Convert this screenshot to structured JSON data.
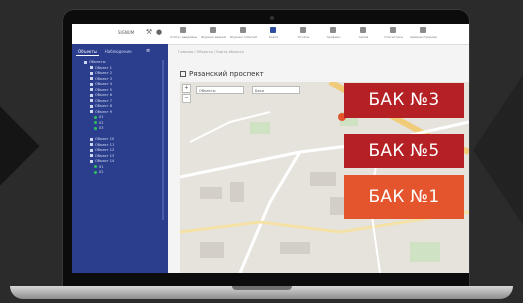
{
  "app": {
    "user_name": "SIGNUM",
    "nav_items": [
      {
        "label": "Статус аварийных",
        "icon": "status-icon"
      },
      {
        "label": "Журнал аварий",
        "icon": "journal-icon"
      },
      {
        "label": "Журнал событий",
        "icon": "events-icon"
      },
      {
        "label": "Карта",
        "icon": "map-icon",
        "active": true
      },
      {
        "label": "Отчёты",
        "icon": "reports-icon"
      },
      {
        "label": "Графики",
        "icon": "charts-icon"
      },
      {
        "label": "Архив",
        "icon": "archive-icon"
      },
      {
        "label": "Статистика",
        "icon": "stats-icon"
      },
      {
        "label": "Администрирование",
        "icon": "admin-icon"
      }
    ]
  },
  "sidebar": {
    "tabs": [
      "Объекты",
      "Наблюдение"
    ],
    "tree": [
      {
        "text": "Объекты",
        "type": "sq",
        "depth": 0
      },
      {
        "text": "Объект 1",
        "type": "sq",
        "depth": 1
      },
      {
        "text": "Объект 2",
        "type": "sq",
        "depth": 1
      },
      {
        "text": "Объект 3",
        "type": "sq",
        "depth": 1
      },
      {
        "text": "Объект 4",
        "type": "sq",
        "depth": 1
      },
      {
        "text": "Объект 5",
        "type": "sq",
        "depth": 1
      },
      {
        "text": "Объект 6",
        "type": "sq",
        "depth": 1
      },
      {
        "text": "Объект 7",
        "type": "sq",
        "depth": 1
      },
      {
        "text": "Объект 8",
        "type": "sq",
        "depth": 1
      },
      {
        "text": "Объект 9",
        "type": "sq",
        "depth": 1
      },
      {
        "text": "01",
        "type": "dot",
        "depth": 2
      },
      {
        "text": "02",
        "type": "dot",
        "depth": 2
      },
      {
        "text": "03",
        "type": "dot",
        "depth": 2
      },
      {
        "text": "",
        "type": "none",
        "depth": 1
      },
      {
        "text": "Объект 10",
        "type": "sq",
        "depth": 1
      },
      {
        "text": "Объект 11",
        "type": "sq",
        "depth": 1
      },
      {
        "text": "Объект 12",
        "type": "sq",
        "depth": 1
      },
      {
        "text": "Объект 13",
        "type": "sq",
        "depth": 1
      },
      {
        "text": "Объект 14",
        "type": "sq",
        "depth": 1
      },
      {
        "text": "01",
        "type": "dot",
        "depth": 2
      },
      {
        "text": "02",
        "type": "dot",
        "depth": 2
      }
    ]
  },
  "content": {
    "breadcrumb": "Главная / Объекты / Карта объекта",
    "page_title": "Рязанский проспект",
    "map_selects": [
      "Объекты",
      "Баки"
    ],
    "tanks": [
      "БАК №3",
      "БАК №5",
      "БАК №1"
    ]
  },
  "colors": {
    "sidebar": "#2b3e8e",
    "tank_red": "#b52024",
    "tank_orange": "#e4552e"
  }
}
